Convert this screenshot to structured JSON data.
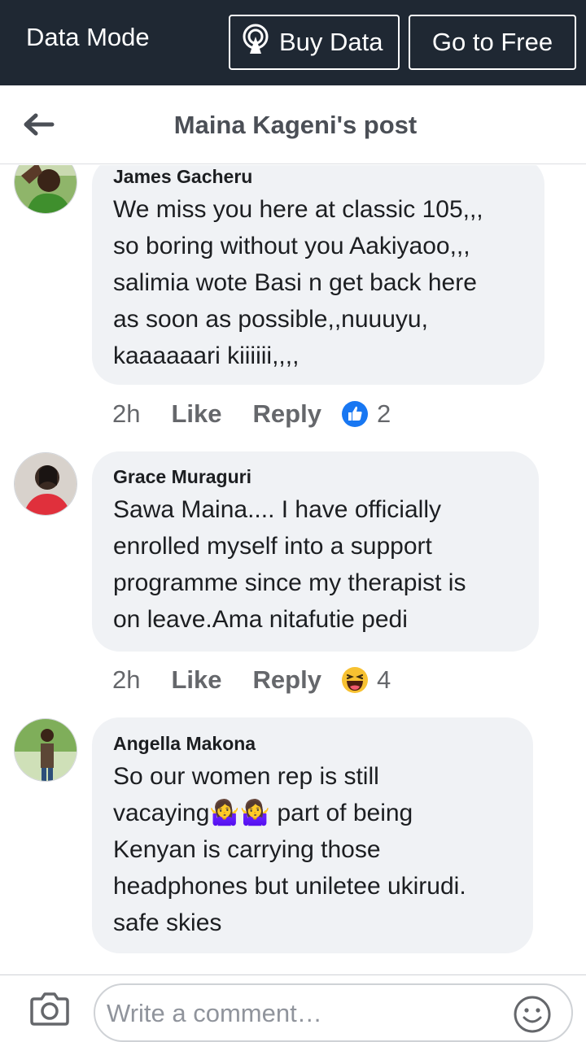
{
  "databar": {
    "mode_label": "Data Mode",
    "buy_label": "Buy Data",
    "free_label": "Go to Free"
  },
  "header": {
    "title": "Maina Kageni's post"
  },
  "comments": [
    {
      "author": "James Gacheru",
      "lines": [
        "We miss you here at classic 105,,,",
        "so boring without you Aakiyaoo,,,",
        "salimia wote Basi n get back here",
        "as soon as possible,,nuuuyu,",
        "kaaaaaari kiiiiii,,,,"
      ],
      "time": "2h",
      "like": "Like",
      "reply": "Reply",
      "reaction_icon": "thumbs-up-icon",
      "reaction_count": "2"
    },
    {
      "author": "Grace Muraguri",
      "lines": [
        "Sawa Maina.... I have officially",
        "enrolled myself into a support",
        "programme since my therapist is",
        "on leave.Ama nitafutie pedi"
      ],
      "time": "2h",
      "like": "Like",
      "reply": "Reply",
      "reaction_icon": "haha-icon",
      "reaction_count": "4"
    },
    {
      "author": "Angella Makona",
      "lines": [
        "So our women rep is still",
        "vacaying🤷‍♀️🤷‍♀️ part of being",
        "Kenyan is carrying those",
        "headphones but uniletee ukirudi.",
        "safe skies"
      ]
    }
  ],
  "composer": {
    "placeholder": "Write a comment…"
  },
  "colors": {
    "databar_bg": "#1f2833",
    "bubble_bg": "#f0f2f5",
    "like_blue": "#1877f2"
  }
}
